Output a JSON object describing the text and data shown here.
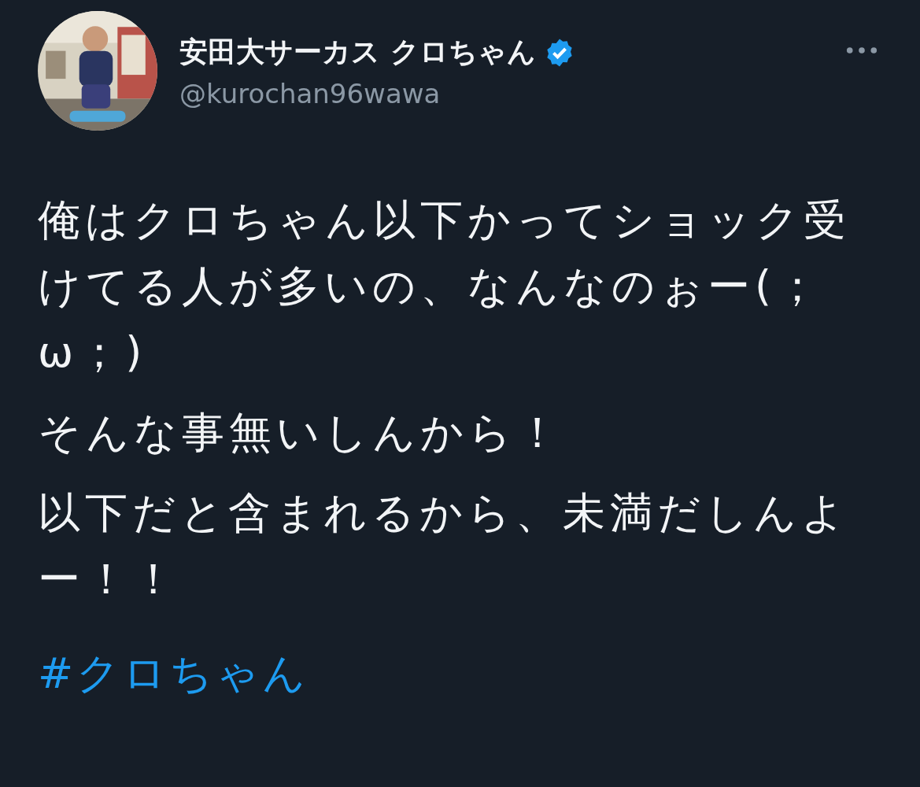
{
  "author": {
    "name": "安田大サーカス クロちゃん",
    "verified": true,
    "handle": "@kurochan96wawa"
  },
  "body": {
    "paragraphs": [
      "俺はクロちゃん以下かってショック受けてる人が多いの、なんなのぉー(；ω；)",
      "そんな事無いしんから！",
      "以下だと含まれるから、未満だしんよー！！"
    ],
    "hashtag": "#クロちゃん"
  }
}
